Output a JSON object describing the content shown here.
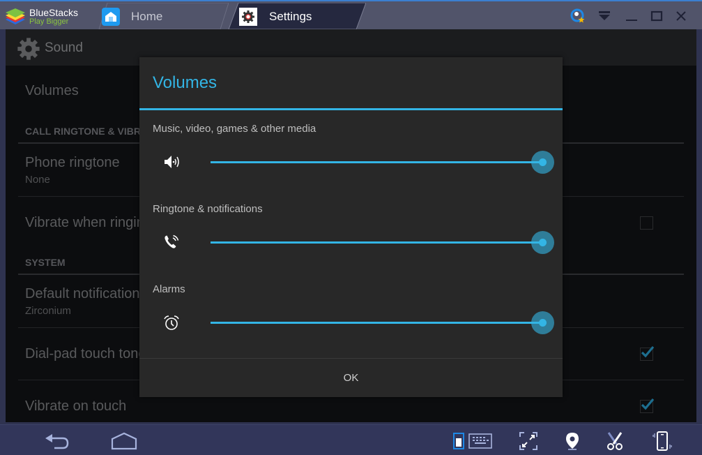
{
  "window": {
    "app_name": "BlueStacks",
    "app_tagline": "Play Bigger",
    "tabs": [
      {
        "label": "Home",
        "icon": "home-icon",
        "active": false
      },
      {
        "label": "Settings",
        "icon": "gear-icon",
        "active": true
      }
    ],
    "controls": [
      "account-icon",
      "menu-dropdown-icon",
      "minimize-icon",
      "maximize-icon",
      "close-icon"
    ]
  },
  "android": {
    "action_bar": {
      "title": "Sound",
      "icon": "gear-icon"
    },
    "preferences": {
      "volumes": {
        "title": "Volumes"
      },
      "category_call": "CALL RINGTONE & VIBRATE",
      "phone_ringtone": {
        "title": "Phone ringtone",
        "summary": "None"
      },
      "vibrate_when_ringing": {
        "title": "Vibrate when ringing",
        "checked": false
      },
      "category_system": "SYSTEM",
      "default_notification": {
        "title": "Default notification sound",
        "summary": "Zirconium"
      },
      "dialpad_touch_tones": {
        "title": "Dial-pad touch tones",
        "checked": true
      },
      "vibrate_on_touch": {
        "title": "Vibrate on touch",
        "checked": true
      }
    },
    "dialog": {
      "title": "Volumes",
      "sliders": [
        {
          "label": "Music, video, games & other media",
          "icon": "speaker-icon",
          "value": 1.0
        },
        {
          "label": "Ringtone & notifications",
          "icon": "phone-ring-icon",
          "value": 1.0
        },
        {
          "label": "Alarms",
          "icon": "alarm-clock-icon",
          "value": 1.0
        }
      ],
      "ok_label": "OK"
    }
  },
  "bottom_bar": {
    "left": [
      "back-icon",
      "home-icon"
    ],
    "right": [
      "portrait-mode-icon",
      "keyboard-icon",
      "fullscreen-icon",
      "location-icon",
      "scissors-icon",
      "shake-icon"
    ]
  },
  "colors": {
    "accent": "#33b5e5",
    "titlebar": "#51546a",
    "bottombar": "#32365a",
    "logo_tagline": "#8bc53f"
  }
}
